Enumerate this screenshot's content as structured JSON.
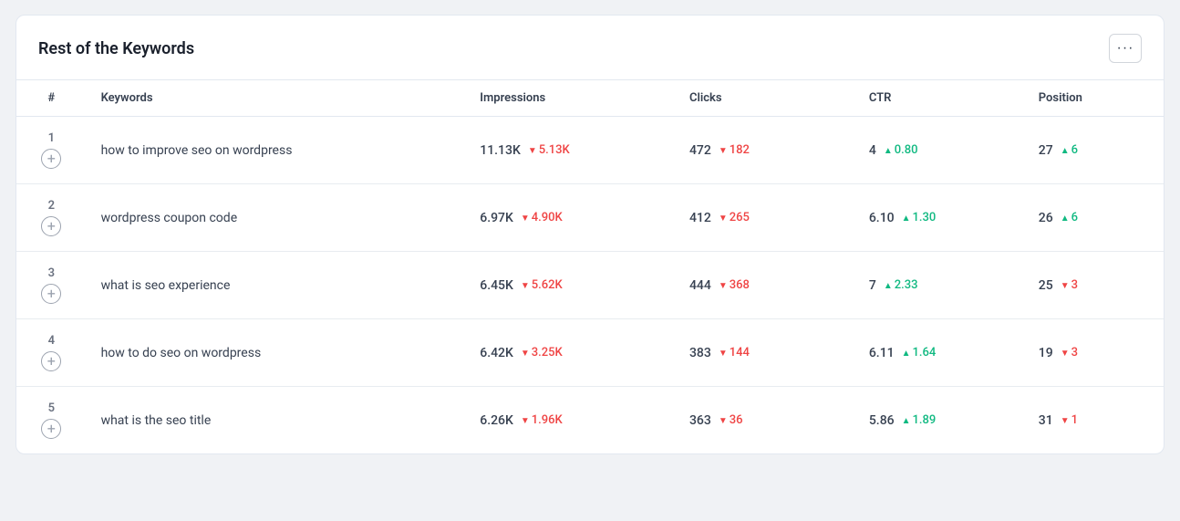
{
  "card": {
    "title": "Rest of the Keywords",
    "more_button_label": "···"
  },
  "columns": {
    "num": "#",
    "keywords": "Keywords",
    "impressions": "Impressions",
    "clicks": "Clicks",
    "ctr": "CTR",
    "position": "Position"
  },
  "rows": [
    {
      "num": "1",
      "keyword": "how to improve seo on wordpress",
      "impressions_main": "11.13K",
      "impressions_delta": "5.13K",
      "impressions_dir": "down",
      "clicks_main": "472",
      "clicks_delta": "182",
      "clicks_dir": "down",
      "ctr_main": "4",
      "ctr_delta": "0.80",
      "ctr_dir": "up",
      "position_main": "27",
      "position_delta": "6",
      "position_dir": "up"
    },
    {
      "num": "2",
      "keyword": "wordpress coupon code",
      "impressions_main": "6.97K",
      "impressions_delta": "4.90K",
      "impressions_dir": "down",
      "clicks_main": "412",
      "clicks_delta": "265",
      "clicks_dir": "down",
      "ctr_main": "6.10",
      "ctr_delta": "1.30",
      "ctr_dir": "up",
      "position_main": "26",
      "position_delta": "6",
      "position_dir": "up"
    },
    {
      "num": "3",
      "keyword": "what is seo experience",
      "impressions_main": "6.45K",
      "impressions_delta": "5.62K",
      "impressions_dir": "down",
      "clicks_main": "444",
      "clicks_delta": "368",
      "clicks_dir": "down",
      "ctr_main": "7",
      "ctr_delta": "2.33",
      "ctr_dir": "up",
      "position_main": "25",
      "position_delta": "3",
      "position_dir": "down"
    },
    {
      "num": "4",
      "keyword": "how to do seo on wordpress",
      "impressions_main": "6.42K",
      "impressions_delta": "3.25K",
      "impressions_dir": "down",
      "clicks_main": "383",
      "clicks_delta": "144",
      "clicks_dir": "down",
      "ctr_main": "6.11",
      "ctr_delta": "1.64",
      "ctr_dir": "up",
      "position_main": "19",
      "position_delta": "3",
      "position_dir": "down"
    },
    {
      "num": "5",
      "keyword": "what is the seo title",
      "impressions_main": "6.26K",
      "impressions_delta": "1.96K",
      "impressions_dir": "down",
      "clicks_main": "363",
      "clicks_delta": "36",
      "clicks_dir": "down",
      "ctr_main": "5.86",
      "ctr_delta": "1.89",
      "ctr_dir": "up",
      "position_main": "31",
      "position_delta": "1",
      "position_dir": "down"
    }
  ]
}
